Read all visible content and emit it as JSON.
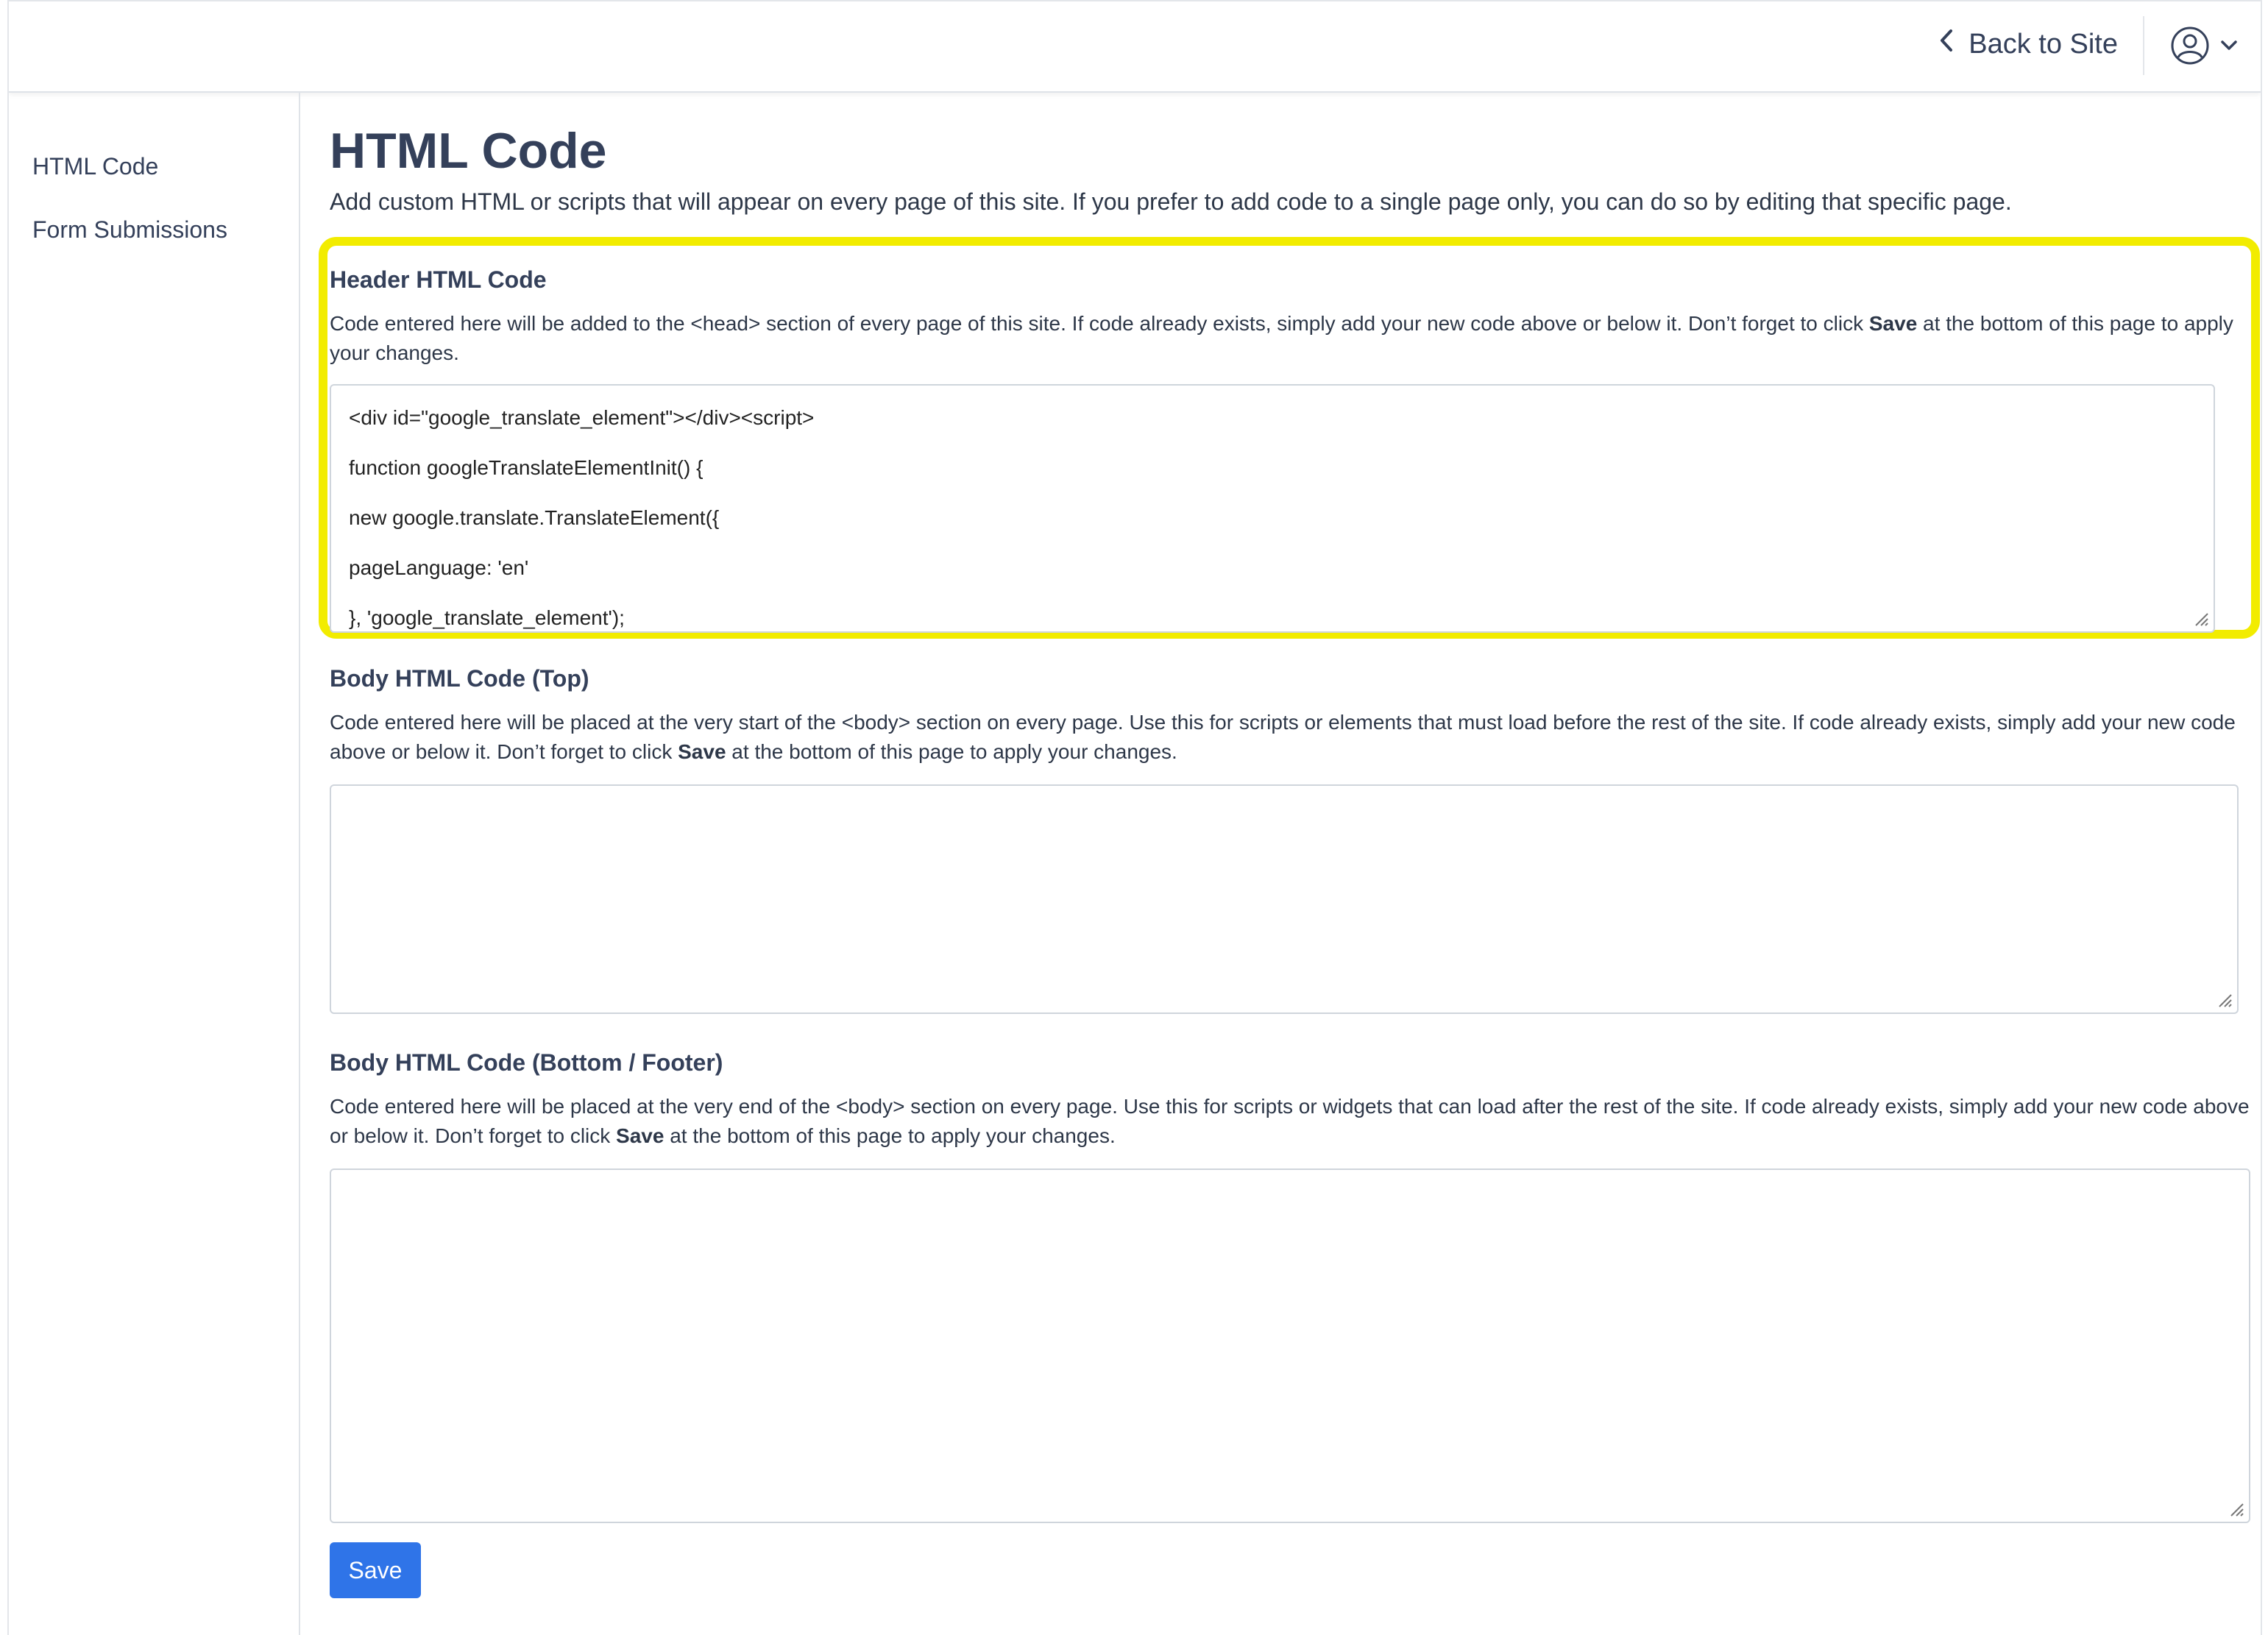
{
  "topbar": {
    "back_label": "Back to Site",
    "back_icon": "chevron-left-icon",
    "user_icon": "user-circle-icon",
    "user_menu_icon": "chevron-down-icon"
  },
  "sidebar": {
    "items": [
      {
        "label": "HTML Code"
      },
      {
        "label": "Form Submissions"
      }
    ]
  },
  "main": {
    "title": "HTML Code",
    "description": "Add custom HTML or scripts that will appear on every page of this site. If you prefer to add code to a single page only, you can do so by editing that specific page.",
    "highlight_color": "#f2ec00",
    "sections": [
      {
        "title": "Header HTML Code",
        "desc_before": "Code entered here will be added to the <head> section of every page of this site. If code already exists, simply add your new code above or below it. Don’t forget to click ",
        "desc_bold": "Save",
        "desc_after": " at the bottom of this page to apply your changes.",
        "code_lines": [
          "<div id=\"google_translate_element\"></div><script>",
          "function googleTranslateElementInit() {",
          "new google.translate.TranslateElement({",
          "pageLanguage: 'en'",
          "}, 'google_translate_element');"
        ]
      },
      {
        "title": "Body HTML Code (Top)",
        "desc_before": "Code entered here will be placed at the very start of the <body> section on every page. Use this for scripts or elements that must load before the rest of the site. If code already exists, simply add your new code above or below it. Don’t forget to click ",
        "desc_bold": "Save",
        "desc_after": " at the bottom of this page to apply your changes.",
        "code_lines": []
      },
      {
        "title": "Body HTML Code (Bottom / Footer)",
        "desc_before": "Code entered here will be placed at the very end of the <body> section on every page. Use this for scripts or widgets that can load after the rest of the site. If code already exists, simply add your new code above or below it. Don’t forget to click ",
        "desc_bold": "Save",
        "desc_after": " at the bottom of this page to apply your changes.",
        "code_lines": []
      }
    ],
    "save_label": "Save",
    "save_color": "#2f74e8"
  }
}
